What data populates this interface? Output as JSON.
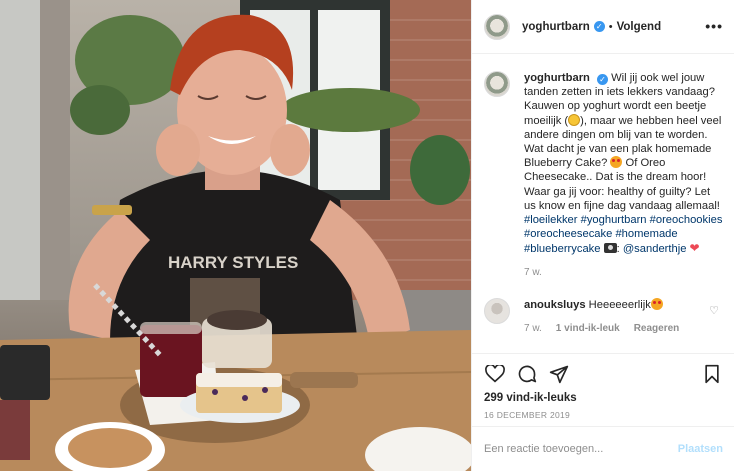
{
  "header": {
    "username": "yoghurtbarn",
    "separator": "•",
    "follow_status": "Volgend",
    "more_label": "•••"
  },
  "caption": {
    "username": "yoghurtbarn",
    "text_1": " Wil jij ook wel jouw tanden zetten in iets lekkers vandaag? Kauwen op yoghurt wordt een beetje moeilijk (",
    "text_2": "), maar we hebben heel veel andere dingen om blij van te worden. Wat dacht je van een plak homemade Blueberry Cake? ",
    "text_3": " Of Oreo Cheesecake.. Dat is the dream hoor! Waar ga jij voor: healthy of guilty? Let us know en fijne dag vandaag allemaal! ",
    "hashtags": [
      "#loeilekker",
      "#yoghurtbarn",
      "#oreochookies",
      "#oreocheesecake",
      "#homemade",
      "#blueberrycake"
    ],
    "mention": "@sanderthje",
    "heart": "❤",
    "time": "7 w."
  },
  "comment": {
    "username": "anouksluys",
    "text": "Heeeeeerlijk",
    "time": "7 w.",
    "likes": "1 vind-ik-leuk",
    "reply": "Reageren",
    "like_icon": "♡"
  },
  "actions": {
    "likes_count": "299 vind-ik-leuks",
    "date": "16 DECEMBER 2019"
  },
  "add_comment": {
    "placeholder": "Een reactie toevoegen...",
    "post_label": "Plaatsen"
  },
  "photo": {
    "shirt_text": "HARRY STYLES"
  },
  "colors": {
    "link": "#00376b",
    "verified": "#3897f0",
    "muted": "#8e8e8e",
    "post_disabled": "#b2dffc",
    "heart": "#ed4956"
  }
}
